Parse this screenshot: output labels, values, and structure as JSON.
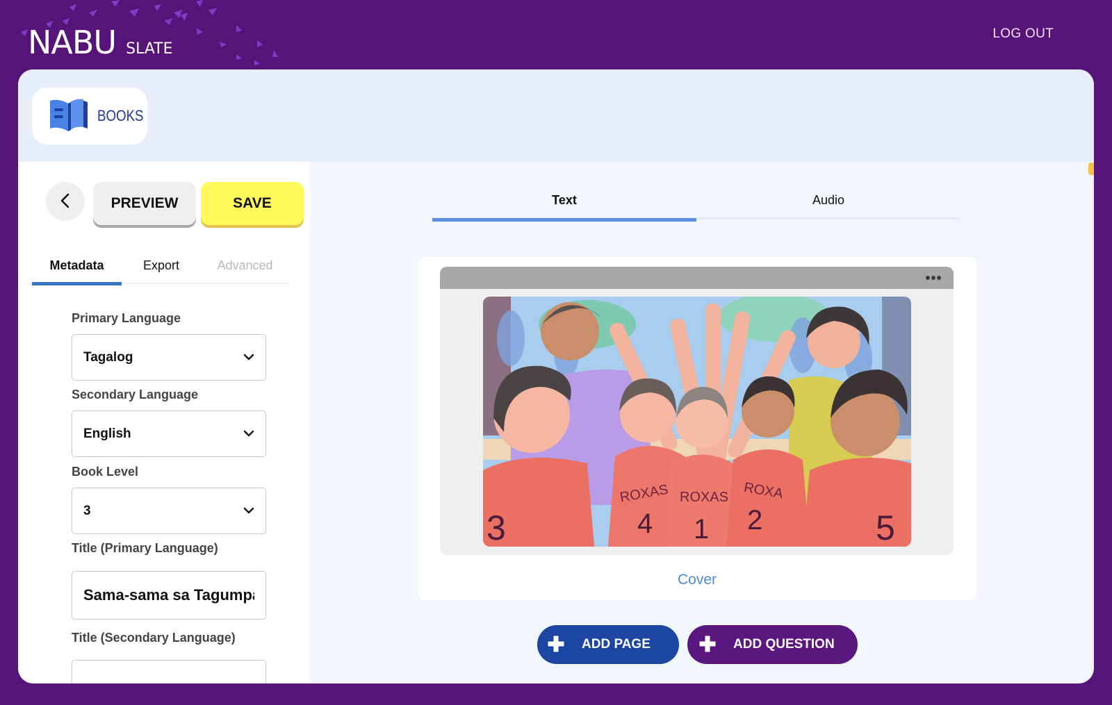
{
  "app": {
    "logo_main": "NABU",
    "logo_sub": "SLATE",
    "logout_label": "LOG OUT"
  },
  "section": {
    "label": "BOOKS",
    "icon": "open-book-icon"
  },
  "toolbar": {
    "back_icon": "chevron-left-icon",
    "preview_label": "PREVIEW",
    "save_label": "SAVE"
  },
  "left_tabs": [
    {
      "label": "Metadata",
      "state": "active"
    },
    {
      "label": "Export",
      "state": "normal"
    },
    {
      "label": "Advanced",
      "state": "disabled"
    }
  ],
  "metadata": {
    "primary_language": {
      "label": "Primary Language",
      "value": "Tagalog"
    },
    "secondary_language": {
      "label": "Secondary Language",
      "value": "English"
    },
    "book_level": {
      "label": "Book Level",
      "value": "3"
    },
    "title_primary": {
      "label": "Title (Primary Language)",
      "value": "Sama-sama sa Tagumpay"
    },
    "title_secondary": {
      "label": "Title (Secondary Language)",
      "value": ""
    }
  },
  "editor_tabs": [
    {
      "label": "Text",
      "state": "active"
    },
    {
      "label": "Audio",
      "state": "normal"
    }
  ],
  "page": {
    "menu_icon": "more-horizontal-icon",
    "image_alt": "Illustration of basketball team in ROXAS jerseys numbered 3, 4, 1, 2, 5 doing a group high-five with two adults",
    "jersey_text": "ROXAS",
    "caption": "Cover"
  },
  "actions": {
    "add_page_label": "ADD PAGE",
    "add_question_label": "ADD QUESTION"
  },
  "colors": {
    "brand_purple": "#561479",
    "save_yellow": "#fff95a",
    "add_page_blue": "#1b47a3",
    "tab_accent": "#3a74c9",
    "cover_link": "#4a8bd8"
  }
}
